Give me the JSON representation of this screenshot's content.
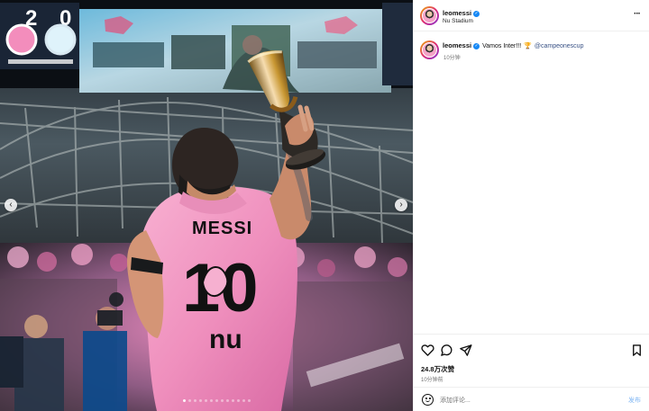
{
  "post": {
    "username": "leomessi",
    "location": "Nu Stadium",
    "caption_username": "leomessi",
    "caption_text": "Vamos Inter!!!",
    "caption_emoji": "🏆",
    "caption_mention": "@campeonescup",
    "caption_time": "10分钟",
    "likes": "24.8万次赞",
    "posted_time": "10分钟前"
  },
  "media": {
    "jersey_name": "MESSI",
    "jersey_number": "10",
    "jersey_sponsor": "nu",
    "scoreboard_home": "2",
    "scoreboard_away": "0"
  },
  "comment": {
    "placeholder": "添加评论...",
    "post_label": "发布"
  },
  "icons": {
    "verified": "verified-badge",
    "more": "more-options-icon",
    "like": "heart-icon",
    "comment": "comment-icon",
    "share": "paper-plane-icon",
    "save": "bookmark-icon",
    "emoji": "smile-icon"
  },
  "colors": {
    "jersey_pink": "#f29bc4",
    "verified_blue": "#1688f5",
    "link_blue": "#385185",
    "post_button_blue": "#7fb6f4"
  }
}
